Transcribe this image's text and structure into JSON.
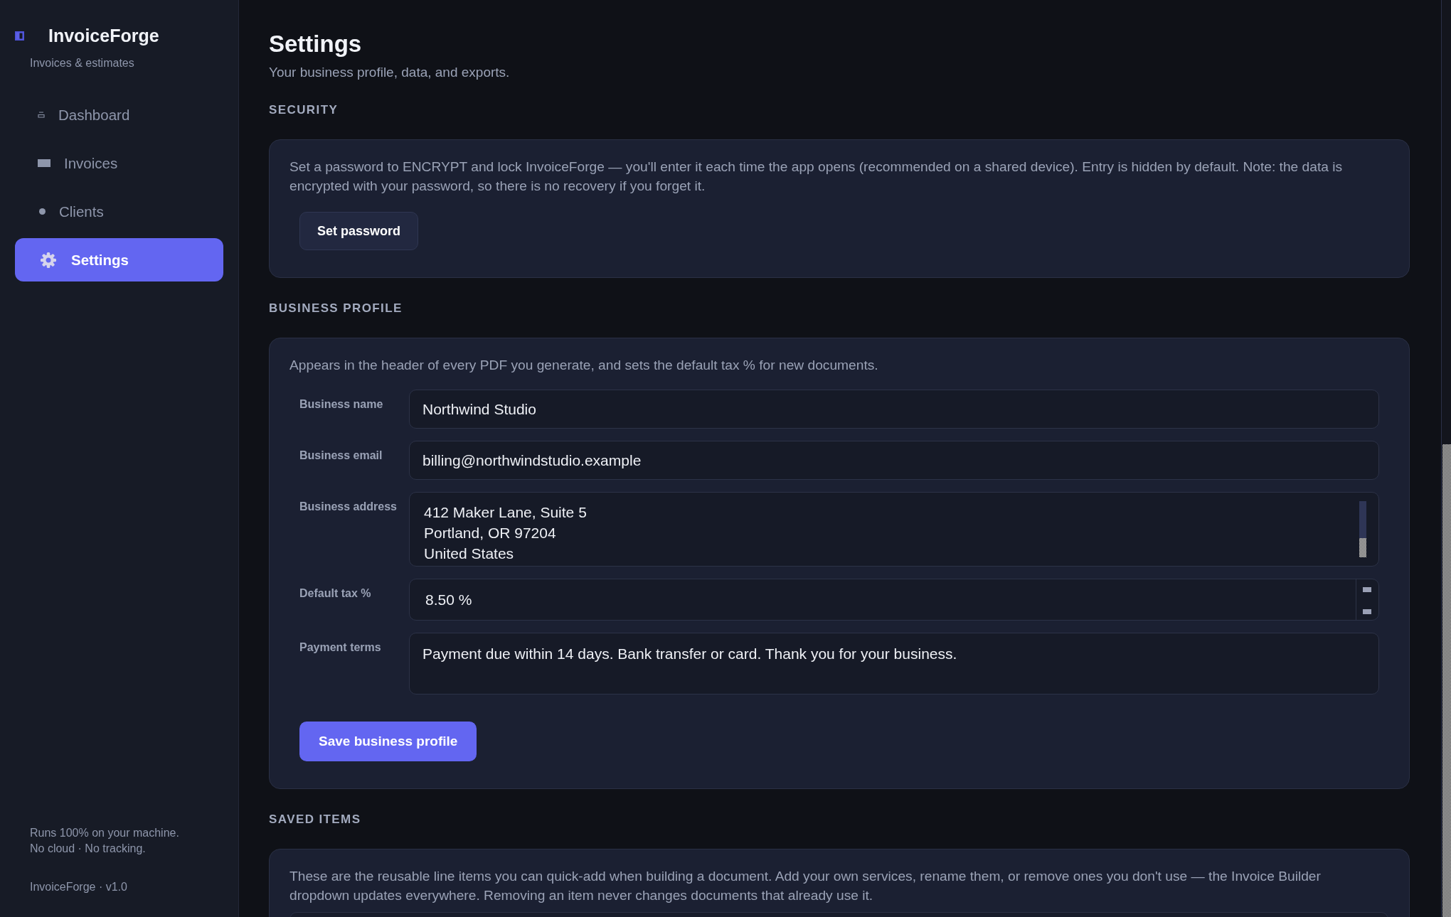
{
  "sidebar": {
    "brand": {
      "title": "InvoiceForge",
      "subtitle": "Invoices & estimates"
    },
    "nav": [
      {
        "label": "Dashboard",
        "selected": false
      },
      {
        "label": "Invoices",
        "selected": false
      },
      {
        "label": "Clients",
        "selected": false
      },
      {
        "label": "Settings",
        "selected": true
      }
    ],
    "footer": {
      "notes": [
        "Runs 100% on your machine.",
        "No cloud · No tracking."
      ],
      "version": "InvoiceForge · v1.0"
    }
  },
  "page": {
    "title": "Settings",
    "subtitle": "Your business profile, data, and exports."
  },
  "sections": [
    {
      "heading": "SECURITY",
      "description": "Set a password to ENCRYPT and lock InvoiceForge — you'll enter it each time the app opens (recommended on a shared device). Entry is hidden by default. Note: the data is encrypted with your password, so there is no recovery if you forget it.",
      "buttons": [
        {
          "label": "Set password",
          "kind": "secondary"
        }
      ]
    },
    {
      "heading": "BUSINESS PROFILE",
      "description": "Appears in the header of every PDF you generate, and sets the default tax % for new documents.",
      "fields": [
        {
          "label": "Business name",
          "kind": "text",
          "value": "Northwind Studio"
        },
        {
          "label": "Business email",
          "kind": "text",
          "value": "billing@northwindstudio.example"
        },
        {
          "label": "Business address",
          "kind": "multiline",
          "value": "412 Maker Lane, Suite 5\nPortland, OR 97204\nUnited States"
        },
        {
          "label": "Default tax %",
          "kind": "number",
          "value": "8.50 %"
        },
        {
          "label": "Payment terms",
          "kind": "multiline",
          "value": "Payment due within 14 days. Bank transfer or card. Thank you for your business."
        }
      ],
      "buttons": [
        {
          "label": "Save business profile",
          "kind": "primary"
        }
      ]
    },
    {
      "heading": "SAVED ITEMS",
      "description": "These are the reusable line items you can quick-add when building a document. Add your own services, rename them, or remove ones you don't use — the Invoice Builder dropdown updates everywhere. Removing an item never changes documents that already use it."
    }
  ]
}
